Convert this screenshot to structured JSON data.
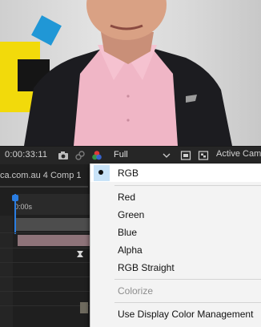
{
  "viewer": {
    "timecode": "0:00:33:11",
    "resolution": "Full",
    "active_camera": "Active Cam"
  },
  "timeline": {
    "comp_tab": "ca.com.au 4 Comp 1",
    "ruler_label": "0:00s"
  },
  "channel_menu": {
    "items": [
      {
        "label": "RGB",
        "selected": true
      },
      {
        "label": "Red"
      },
      {
        "label": "Green"
      },
      {
        "label": "Blue"
      },
      {
        "label": "Alpha"
      },
      {
        "label": "RGB Straight"
      },
      {
        "label": "Colorize",
        "disabled": true
      },
      {
        "label": "Use Display Color Management"
      }
    ]
  },
  "colors": {
    "accent": "#2a7de1",
    "selection_highlight": "#c9e3f8",
    "shirt_pink": "#f0b6c6",
    "background_yellow": "#f2da0b",
    "background_blue": "#2097d6"
  }
}
